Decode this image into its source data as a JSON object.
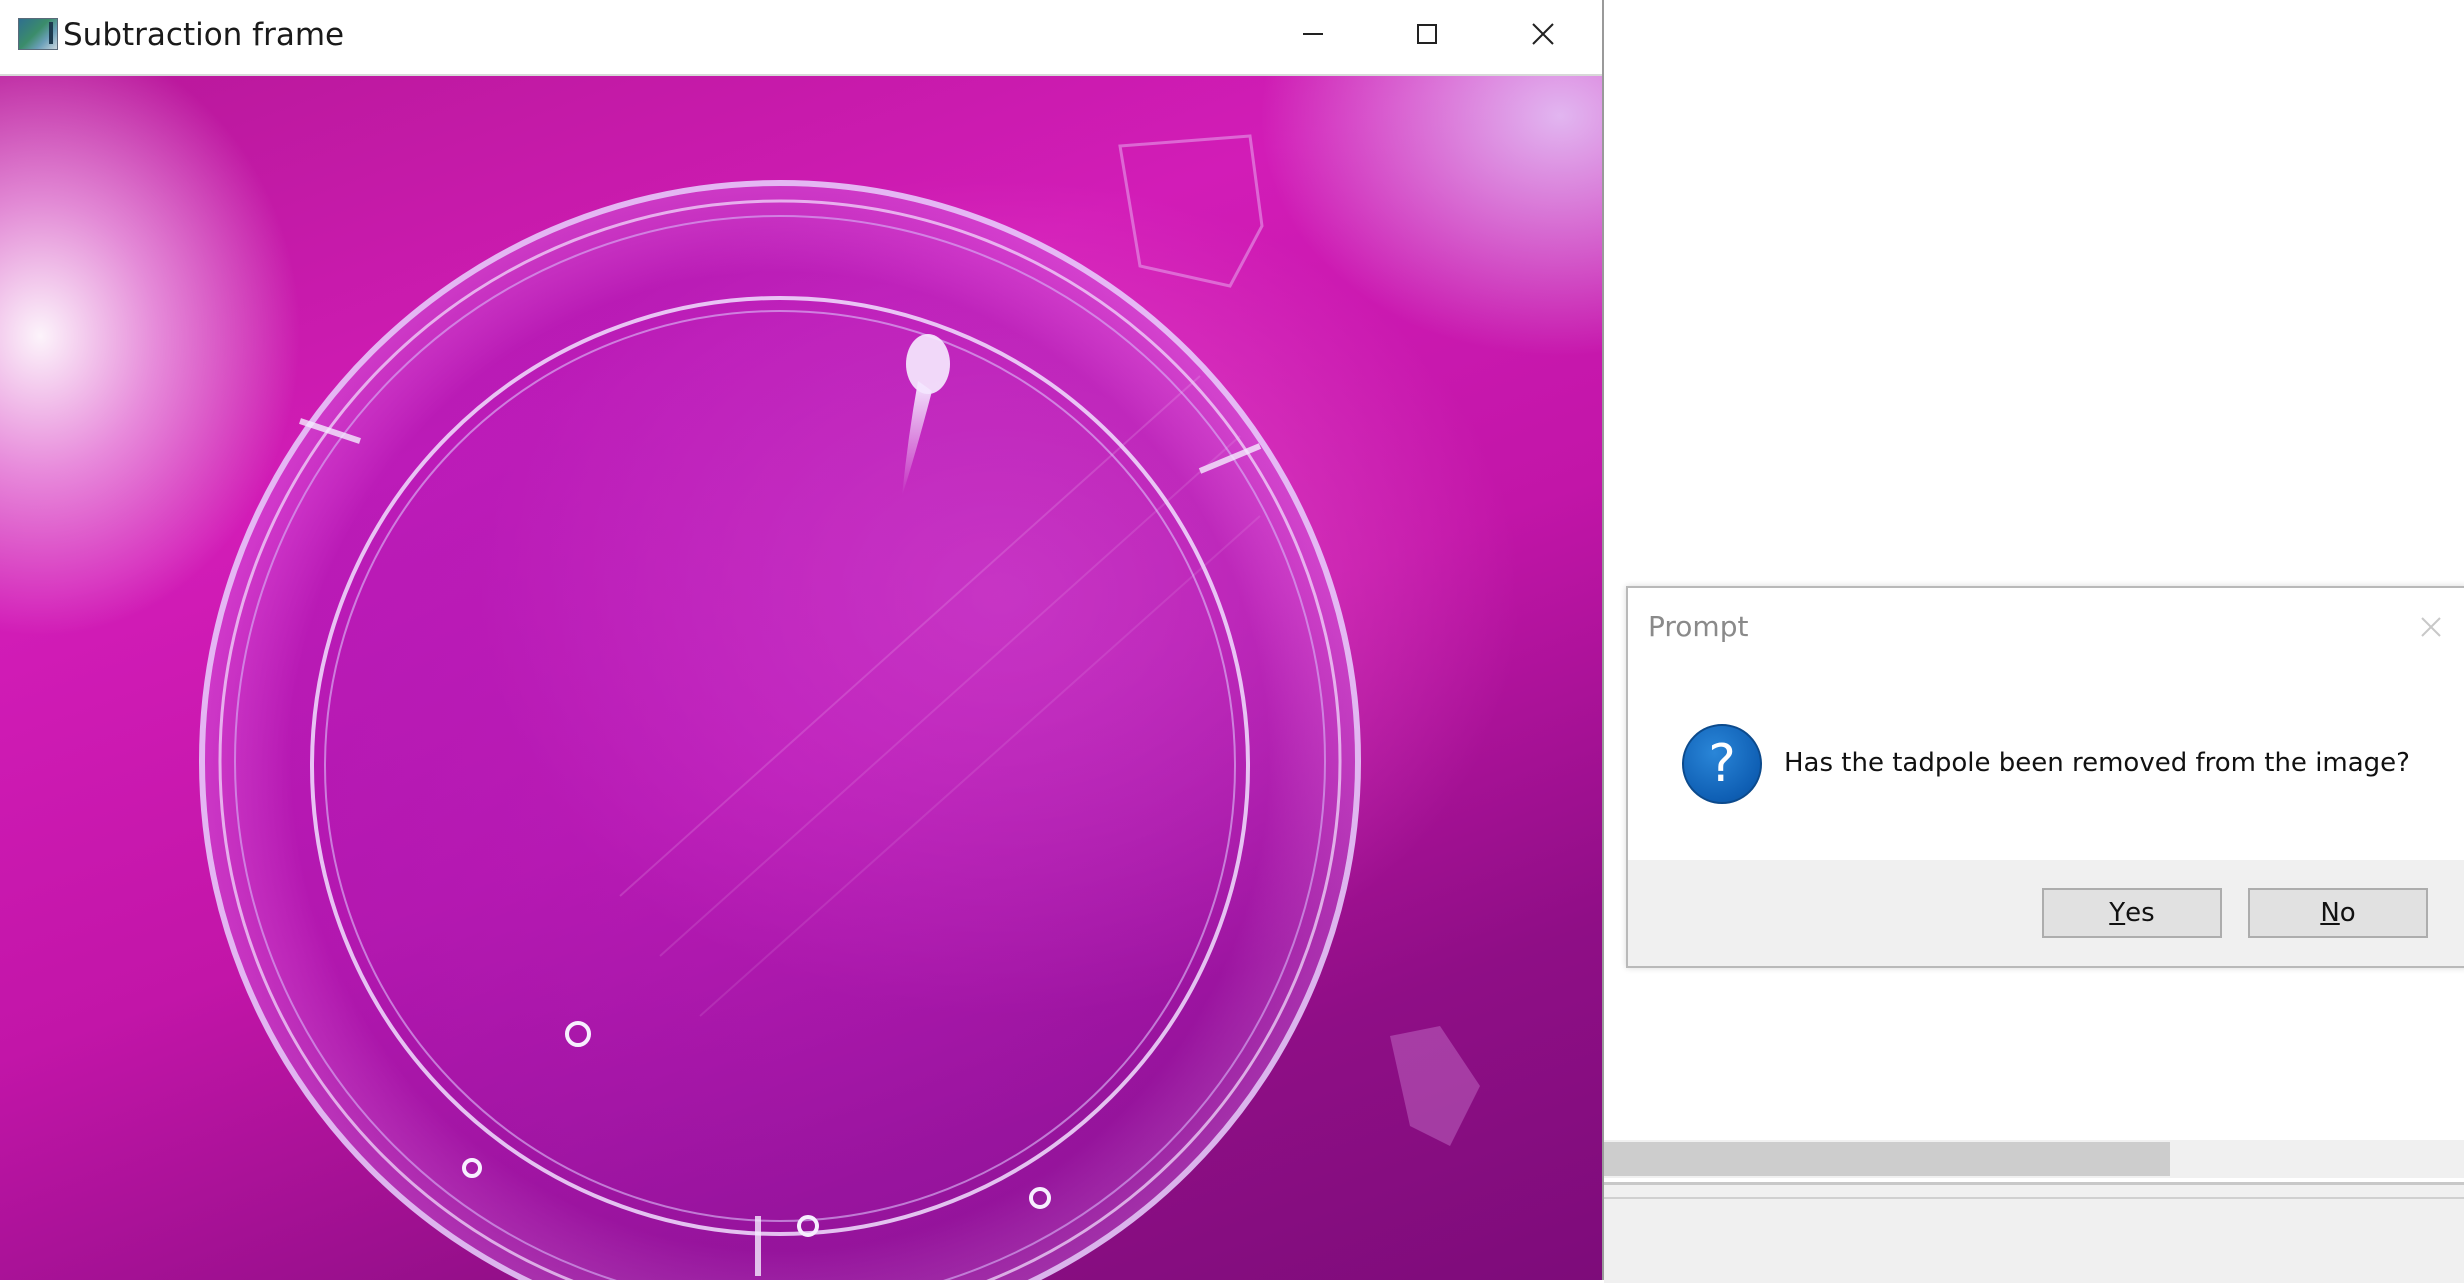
{
  "image_window": {
    "title": "Subtraction frame",
    "icons": {
      "app": "image-window-app-icon",
      "minimize": "minimize-icon",
      "maximize": "maximize-icon",
      "close": "close-icon"
    }
  },
  "dialog": {
    "title": "Prompt",
    "message": "Has the tadpole been removed from the image?",
    "icon": "question-icon",
    "icon_glyph": "?",
    "close_icon": "close-icon",
    "buttons": {
      "yes": {
        "mnemonic": "Y",
        "rest": "es"
      },
      "no": {
        "mnemonic": "N",
        "rest": "o"
      }
    }
  },
  "colors": {
    "background_magenta": "#c215a8",
    "question_blue": "#0f5fb4",
    "button_face": "#e1e1e1"
  }
}
